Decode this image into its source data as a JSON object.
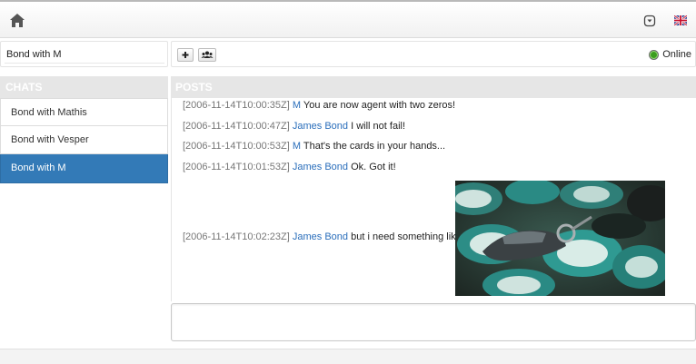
{
  "navbar": {
    "home_icon": "home-icon",
    "status_icon": "circle-dot-icon",
    "language_icon": "uk-flag-icon"
  },
  "chat_title": {
    "value": "Bond with M"
  },
  "chats": {
    "header": "CHATS",
    "items": [
      {
        "label": "Bond with Mathis",
        "active": false
      },
      {
        "label": "Bond with Vesper",
        "active": false
      },
      {
        "label": "Bond with M",
        "active": true
      }
    ]
  },
  "toolbar": {
    "add_icon": "plus-icon",
    "users_icon": "users-icon",
    "status_label": "Online",
    "status_color": "#3c9d1f"
  },
  "posts": {
    "header": "POSTS",
    "items": [
      {
        "timestamp": "[2006-11-14T10:00:35Z]",
        "author": "M",
        "text": "You are now agent with two zeros!"
      },
      {
        "timestamp": "[2006-11-14T10:00:47Z]",
        "author": "James Bond",
        "text": "I will not fail!"
      },
      {
        "timestamp": "[2006-11-14T10:00:53Z]",
        "author": "M",
        "text": "That's the cards in your hands..."
      },
      {
        "timestamp": "[2006-11-14T10:01:53Z]",
        "author": "James Bond",
        "text": "Ok. Got it!"
      },
      {
        "timestamp": "[2006-11-14T10:02:23Z]",
        "author": "James Bond",
        "text": "but i need something like:",
        "has_image": true
      }
    ]
  },
  "composer": {
    "value": "",
    "placeholder": ""
  },
  "colors": {
    "accent": "#337ab7",
    "author_link": "#2a6ebb",
    "header_bar": "#e6e6e6"
  }
}
